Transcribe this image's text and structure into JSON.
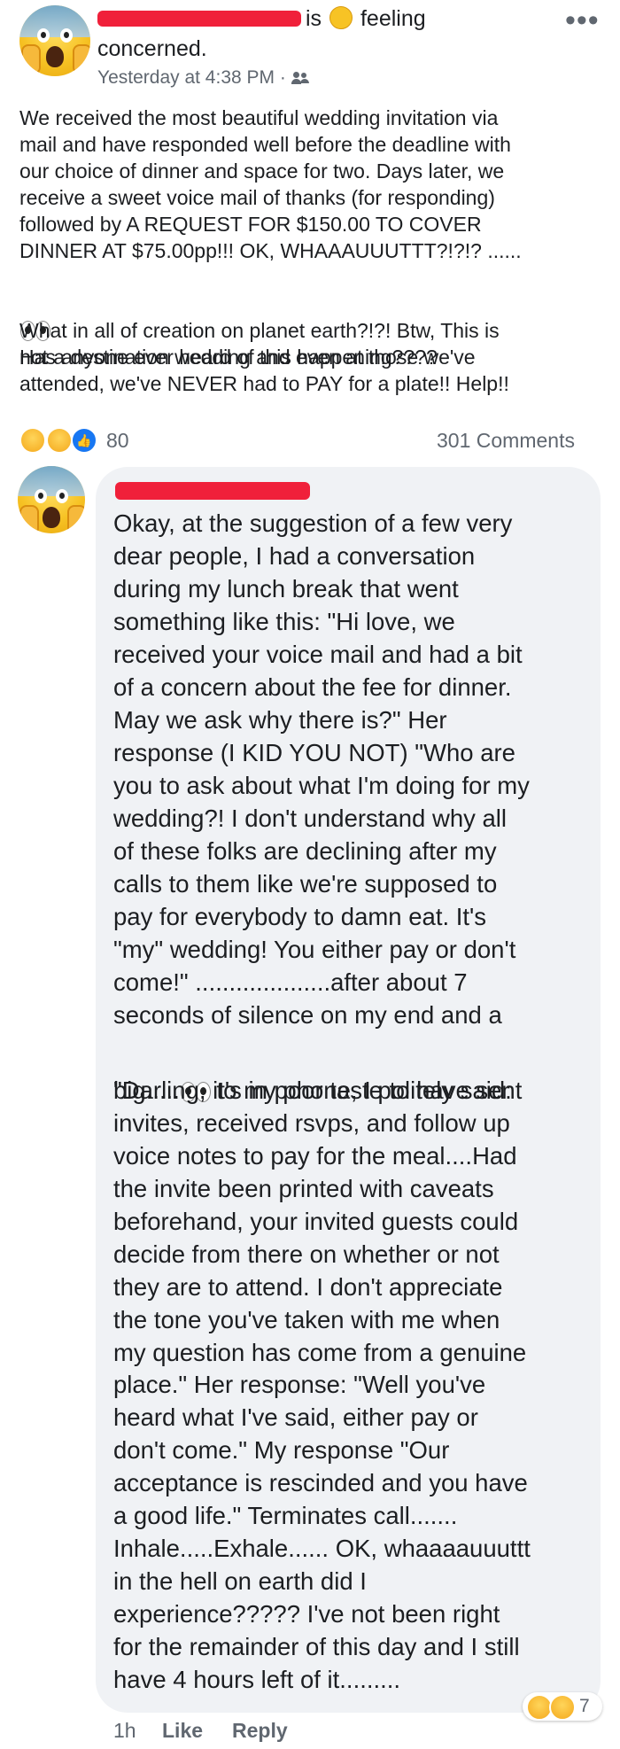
{
  "post": {
    "author_suffix": "is",
    "feeling_text": "feeling",
    "feeling_word": "concerned.",
    "timestamp": "Yesterday at 4:38 PM ·",
    "audience_icon": "friends-icon",
    "more_icon": "more-icon",
    "body_p1": "We received the most beautiful wedding invitation via\nmail and have responded well before the deadline with\nour choice of dinner and space for two. Days later, we\nreceive a sweet voice mail of thanks (for responding)\nfollowed by A REQUEST FOR $150.00 TO COVER\nDINNER AT $75.00pp!!! OK, WHAAAUUUTTT?!?!? ......",
    "body_p2a": "Has anyone ever heard of this happening????",
    "body_p2b": "What in all of creation on planet earth?!?! Btw, This is\nnot a destination wedding and even at those we've\nattended, we've NEVER had to PAY for a plate!! Help!!"
  },
  "reactions": {
    "count": "80",
    "comments": "301 Comments",
    "types": [
      "wow",
      "haha",
      "like"
    ]
  },
  "comment": {
    "text_part1": "Okay, at the suggestion of a few very\ndear people, I had a conversation\nduring my lunch break that went\nsomething like this: \"Hi love, we\nreceived your voice mail and had a bit\nof a concern about the fee for dinner.\nMay we ask why there is?\" Her\nresponse (I KID YOU NOT) \"Who are\nyou to ask about what I'm doing for my\nwedding?! I don't understand why all\nof these folks are declining after my\ncalls to them like we're supposed to\npay for everybody to damn eat. It's\n\"my\" wedding! You either pay or don't\ncome!\" ....................after about 7\nseconds of silence on my end and a",
    "text_big": "big.....",
    "text_after_eyes": " to my phone, I politely said:",
    "text_part2": "\"Darling, it's in poor taste to have sent\ninvites, received rsvps, and follow up\nvoice notes to pay for the meal....Had\nthe invite been printed with caveats\nbeforehand, your invited guests could\ndecide from there on whether or not\nthey are to attend. I don't appreciate\nthe tone you've taken with me when\nmy question has come from a genuine",
    "text_part3": "place.\"  Her response: \"Well you've\nheard what I've said, either pay or\ndon't come.\" My response \"Our\nacceptance is rescinded and you have\na good life.\" Terminates call.......\nInhale.....Exhale...... OK, whaaaauuuttt\nin the hell on earth did I\nexperience?????  I've not been right\nfor the remainder of this day and I still\nhave 4 hours left of it.........",
    "time": "1h",
    "like_label": "Like",
    "reply_label": "Reply",
    "reaction_count": "7"
  }
}
